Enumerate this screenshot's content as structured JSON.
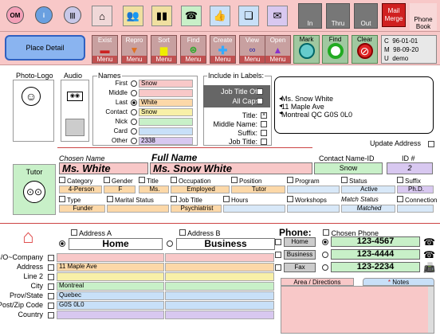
{
  "toolbar": {
    "circles": [
      {
        "label": "OM",
        "color": "#f4a0b8"
      },
      {
        "label": "i",
        "color": "#6aa0e0"
      },
      {
        "label": "|||",
        "color": "#c8c8e8"
      }
    ],
    "tool_icons": [
      "house-icon",
      "people-icon",
      "group-icon",
      "phone-icon",
      "thumb-icon",
      "stack-icon",
      "envelope-icon"
    ],
    "right_buttons": [
      {
        "label": "In"
      },
      {
        "label": "Thru"
      },
      {
        "label": "Out"
      }
    ],
    "mail_merge_label": "Mail Merge",
    "phone_book_label": "Phone Book"
  },
  "commands": {
    "place_detail": "Place Detail",
    "menu_buttons": [
      {
        "top": "Exist",
        "bottom": "Menu",
        "icon": "minus-icon"
      },
      {
        "top": "Repro",
        "bottom": "Menu",
        "icon": "triangle-down-icon"
      },
      {
        "top": "Sort",
        "bottom": "Menu",
        "icon": "bars-icon"
      },
      {
        "top": "Find",
        "bottom": "Menu",
        "icon": "equals-icon"
      },
      {
        "top": "Create",
        "bottom": "Menu",
        "icon": "plus-icon"
      },
      {
        "top": "View",
        "bottom": "Menu",
        "icon": "glasses-icon"
      },
      {
        "top": "Open",
        "bottom": "Menu",
        "icon": "triangle-up-icon"
      }
    ],
    "green_buttons": [
      {
        "label": "Mark"
      },
      {
        "label": "Find"
      },
      {
        "label": "Clear"
      }
    ],
    "meta": {
      "c": "C",
      "m": "M",
      "u": "U",
      "created": "96-01-01",
      "modified": "98-09-20",
      "user": "demo"
    }
  },
  "photo_logo_label": "Photo-Logo",
  "audio_label": "Audio",
  "names": {
    "title": "Names",
    "rows": [
      {
        "label": "First",
        "value": "Snow",
        "color": "pink"
      },
      {
        "label": "Middle",
        "value": "",
        "color": "pink"
      },
      {
        "label": "Last",
        "value": "White",
        "color": "peach"
      },
      {
        "label": "Contact",
        "value": "Snow",
        "color": "yellow"
      },
      {
        "label": "Nick",
        "value": "",
        "color": "green"
      },
      {
        "label": "Card",
        "value": "",
        "color": "blue"
      },
      {
        "label": "Other",
        "value": "2338",
        "color": "purple"
      }
    ]
  },
  "labels": {
    "title": "Include in Labels:",
    "job_title_off": "Job Title Off",
    "all_caps": "All Caps",
    "rows": [
      "Title:",
      "Middle Name:",
      "Suffix:",
      "Job Title:"
    ],
    "preview": [
      "Ms. Snow White",
      "11 Maple Ave",
      "Montreal QC  G0S 0L0"
    ],
    "update_address": "Update Address"
  },
  "summary": {
    "chosen_name_label": "Chosen Name",
    "full_name_label": "Full Name",
    "contact_name_id_label": "Contact Name-ID",
    "id_label": "ID #",
    "chosen_name": "Ms. White",
    "full_name": "Ms. Snow White",
    "contact_name_id": "Snow",
    "id": "2"
  },
  "role": {
    "label": "Tutor",
    "row1_labels": [
      "Category",
      "Gender",
      "Title",
      "Occupation",
      "Position",
      "Program",
      "Status",
      "Suffix"
    ],
    "row1_values": [
      "4-Person",
      "F",
      "Ms.",
      "Employed",
      "Tutor",
      "",
      "Active",
      "Ph.D."
    ],
    "row2_labels": [
      "Type",
      "Marital Status",
      "Job Title",
      "Hours",
      "Workshops",
      "Match Status",
      "Connection"
    ],
    "row2_values": [
      "Funder",
      "",
      "Psychiatrist",
      "",
      "",
      "Matched",
      ""
    ]
  },
  "address": {
    "a_label": "Address A",
    "b_label": "Address B",
    "home": "Home",
    "business": "Business",
    "rows": [
      {
        "label": "C/O~Company",
        "a": "",
        "b": ""
      },
      {
        "label": "Address",
        "a": "11 Maple Ave",
        "b": ""
      },
      {
        "label": "Line 2",
        "a": "",
        "b": ""
      },
      {
        "label": "City",
        "a": "Montreal",
        "b": ""
      },
      {
        "label": "Prov/State",
        "a": "Quebec",
        "b": ""
      },
      {
        "label": "Post/Zip Code",
        "a": "G0S 0L0",
        "b": ""
      },
      {
        "label": "Country",
        "a": "",
        "b": ""
      }
    ]
  },
  "phone": {
    "title": "Phone:",
    "chosen_label": "Chosen Phone",
    "rows": [
      {
        "label": "Home",
        "value": "123-4567"
      },
      {
        "label": "Business",
        "value": "123-4444"
      },
      {
        "label": "Fax",
        "value": "123-2234"
      }
    ],
    "tab_area": "Area / Directions",
    "tab_notes": "Notes"
  }
}
